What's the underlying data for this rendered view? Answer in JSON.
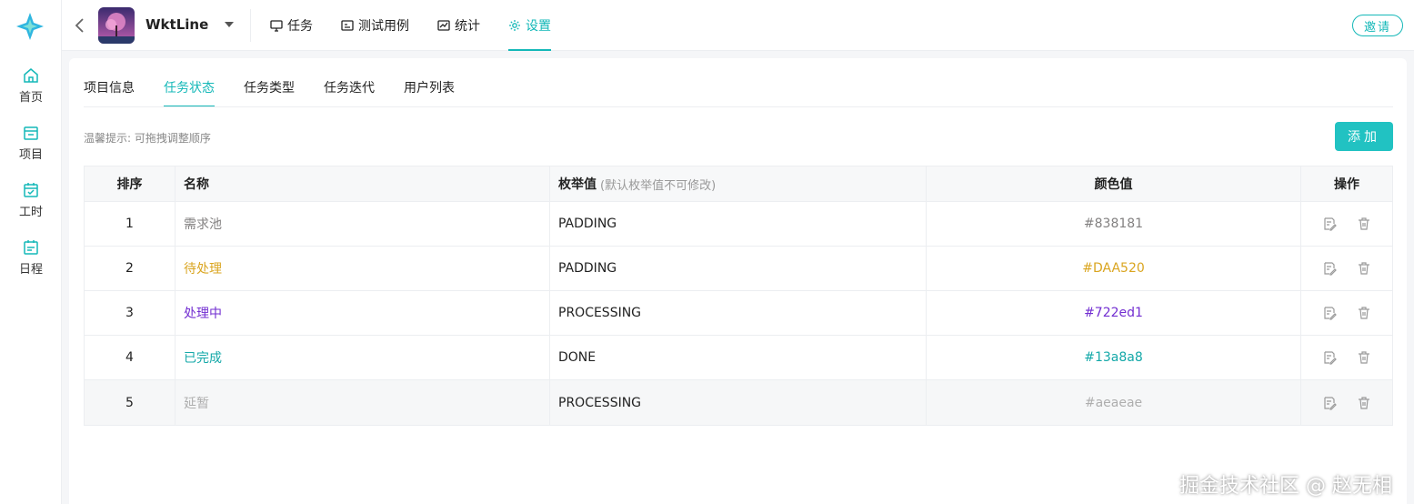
{
  "nav": {
    "items": [
      {
        "label": "首页",
        "icon": "home-icon"
      },
      {
        "label": "项目",
        "icon": "store-icon"
      },
      {
        "label": "工时",
        "icon": "calendar-check-icon"
      },
      {
        "label": "日程",
        "icon": "schedule-icon"
      }
    ]
  },
  "header": {
    "project_name": "WktLine",
    "tabs": [
      {
        "label": "任务",
        "icon": "monitor-icon"
      },
      {
        "label": "测试用例",
        "icon": "testcase-icon"
      },
      {
        "label": "统计",
        "icon": "chart-icon"
      },
      {
        "label": "设置",
        "icon": "gear-icon",
        "active": true
      }
    ],
    "invite_label": "邀请"
  },
  "settings": {
    "tabs": [
      {
        "label": "项目信息"
      },
      {
        "label": "任务状态",
        "active": true
      },
      {
        "label": "任务类型"
      },
      {
        "label": "任务迭代"
      },
      {
        "label": "用户列表"
      }
    ],
    "hint": "温馨提示: 可拖拽调整顺序",
    "add_label": "添加"
  },
  "table": {
    "headers": {
      "order": "排序",
      "name": "名称",
      "enum": "枚举值",
      "enum_note": "(默认枚举值不可修改)",
      "color": "颜色值",
      "ops": "操作"
    },
    "rows": [
      {
        "order": "1",
        "name": "需求池",
        "enum": "PADDING",
        "color": "#838181"
      },
      {
        "order": "2",
        "name": "待处理",
        "enum": "PADDING",
        "color": "#DAA520"
      },
      {
        "order": "3",
        "name": "处理中",
        "enum": "PROCESSING",
        "color": "#722ed1"
      },
      {
        "order": "4",
        "name": "已完成",
        "enum": "DONE",
        "color": "#13a8a8"
      },
      {
        "order": "5",
        "name": "延暂",
        "enum": "PROCESSING",
        "color": "#aeaeae"
      }
    ]
  },
  "watermark": "掘金技术社区 @ 赵无相",
  "colors": {
    "accent": "#14b8b8",
    "add_button": "#21c2c2"
  }
}
